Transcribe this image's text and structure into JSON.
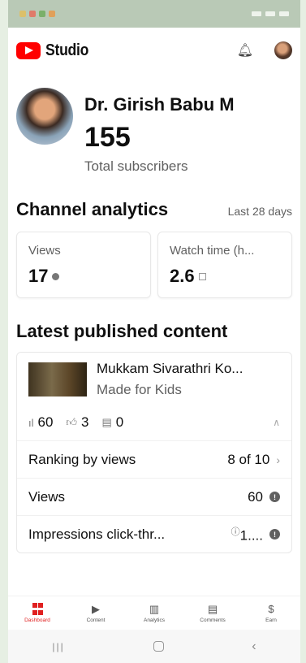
{
  "app": {
    "name": "Studio"
  },
  "channel": {
    "name": "Dr. Girish Babu M",
    "subscriber_count": "155",
    "subscriber_label": "Total subscribers"
  },
  "analytics": {
    "title": "Channel analytics",
    "period": "Last 28 days",
    "cards": [
      {
        "label": "Views",
        "value": "17"
      },
      {
        "label": "Watch time (h...",
        "value": "2.6"
      }
    ]
  },
  "latest": {
    "title": "Latest published content",
    "video": {
      "title": "Mukkam Sivarathri Ko...",
      "subtitle": "Made for Kids",
      "views": "60",
      "likes": "3",
      "comments": "0"
    },
    "details": [
      {
        "label": "Ranking by views",
        "value": "8 of 10"
      },
      {
        "label": "Views",
        "value": "60"
      },
      {
        "label": "Impressions click-thr...",
        "value": "1...."
      }
    ]
  },
  "bottom_nav": [
    {
      "label": "Dashboard",
      "icon": "dashboard-icon",
      "active": true
    },
    {
      "label": "Content",
      "icon": "content-icon"
    },
    {
      "label": "Analytics",
      "icon": "analytics-icon"
    },
    {
      "label": "Comments",
      "icon": "comments-icon"
    },
    {
      "label": "Earn",
      "icon": "earn-icon"
    }
  ],
  "colors": {
    "brand_red": "#ff0000",
    "status_bar": "#b9c9b6",
    "background": "#e6efe3"
  }
}
